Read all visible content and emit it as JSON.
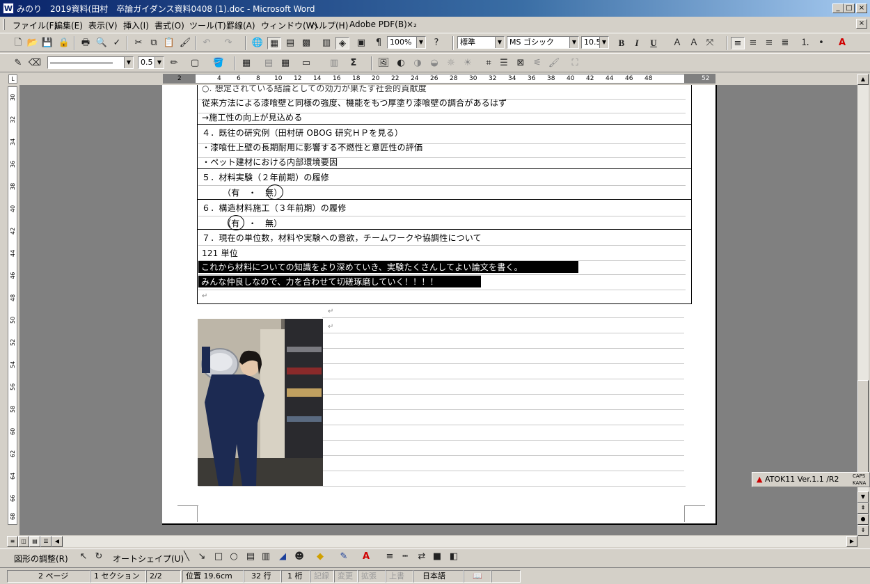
{
  "window": {
    "icon_label": "W",
    "title": "みのり　2019資料(田村　卒論ガイダンス資料0408 (1).doc - Microsoft Word",
    "controls": {
      "minimize": "_",
      "maximize": "□",
      "close": "×"
    },
    "doc_close": "×"
  },
  "menubar": {
    "items": [
      "ファイル(F)",
      "編集(E)",
      "表示(V)",
      "挿入(I)",
      "書式(O)",
      "ツール(T)",
      "罫線(A)",
      "ウィンドウ(W)",
      "ヘルプ(H)",
      "Adobe PDF(B)",
      "×₂"
    ]
  },
  "toolbar": {
    "zoom": "100%",
    "style": "標準",
    "font": "MS ゴシック",
    "font_size": "10.5",
    "bold": "B",
    "italic": "I",
    "underline": "U",
    "line_weight": "0.5",
    "sum": "Σ"
  },
  "ruler": {
    "numbers": [
      "2",
      "2",
      "4",
      "6",
      "8",
      "10",
      "12",
      "14",
      "16",
      "18",
      "20",
      "22",
      "24",
      "26",
      "28",
      "30",
      "32",
      "34",
      "36",
      "38",
      "40",
      "42",
      "44",
      "46",
      "48",
      "52"
    ],
    "vertical": [
      "30",
      "32",
      "34",
      "36",
      "38",
      "40",
      "42",
      "44",
      "46",
      "48",
      "50",
      "52",
      "54",
      "56",
      "58",
      "60",
      "62",
      "64",
      "66",
      "68"
    ],
    "tab_mark": "L"
  },
  "document": {
    "section3": {
      "cutoff": "○. 想定されている結論としての効力が果たす社会的貢献度",
      "line1": "従来方法による漆喰壁と同様の強度、機能をもつ厚塗り漆喰壁の調合があるはず",
      "line2": "→施工性の向上が見込める"
    },
    "section4": {
      "heading": "４．既往の研究例（田村研 OBOG 研究ＨＰを見る）",
      "line1": "・漆喰仕上壁の長期耐用に影響する不燃性と意匠性の評価",
      "line2": "・ペット建材における内部環境要因"
    },
    "section5": {
      "heading": "５．材料実験（２年前期）の履修",
      "options": "（有　・　無）"
    },
    "section6": {
      "heading": "６．構造材料施工（３年前期）の履修",
      "options": "（有　・　無）"
    },
    "section7": {
      "heading": "７．現在の単位数，材料や実験への意欲，チームワークや協調性について",
      "units": "121 単位",
      "hl1": "これから材料についての知識をより深めていき、実験たくさんしてよい論文を書く。",
      "hl2": "みんな仲良しなので、力を合わせて切磋琢磨していく！！！！"
    },
    "para_mark": "↵"
  },
  "photo": {
    "description": "person holding metal bowl in workshop"
  },
  "atok": {
    "label": "ATOK11 Ver.1.1 /R2",
    "caps": "CAPS",
    "kana": "KANA"
  },
  "drawbar": {
    "adjust": "図形の調整(R)",
    "autoshape": "オートシェイプ(U)"
  },
  "statusbar": {
    "page": "2 ページ",
    "section": "1 セクション",
    "pages": "2/2",
    "position": "位置 19.6cm",
    "line": "32 行",
    "col": "1 桁",
    "rec": "記録",
    "trk": "変更",
    "ext": "拡張",
    "ovr": "上書",
    "lang": "日本語"
  }
}
